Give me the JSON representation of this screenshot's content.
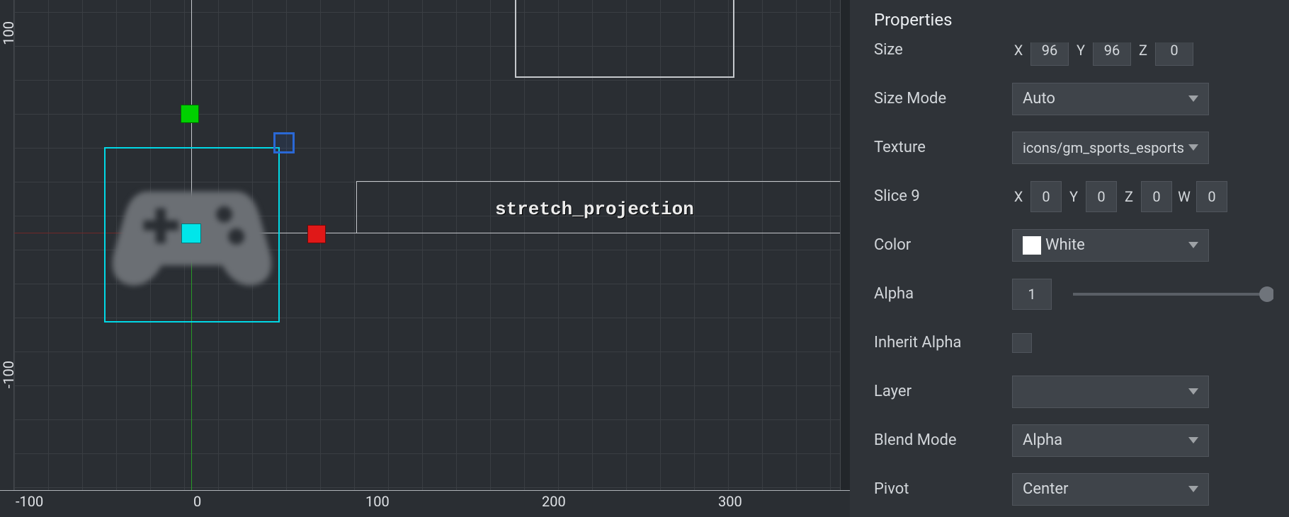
{
  "viewport": {
    "node_label": "stretch_projection",
    "ruler_x": [
      "-100",
      "0",
      "100",
      "200",
      "300"
    ],
    "ruler_y_top": "100",
    "ruler_y_bottom": "-100"
  },
  "properties": {
    "title": "Properties",
    "size": {
      "label": "Size",
      "xl": "X",
      "xv": "96",
      "yl": "Y",
      "yv": "96",
      "zl": "Z",
      "zv": "0"
    },
    "size_mode": {
      "label": "Size Mode",
      "value": "Auto"
    },
    "texture": {
      "label": "Texture",
      "value": "icons/gm_sports_esports"
    },
    "slice9": {
      "label": "Slice 9",
      "xl": "X",
      "xv": "0",
      "yl": "Y",
      "yv": "0",
      "zl": "Z",
      "zv": "0",
      "wl": "W",
      "wv": "0"
    },
    "color": {
      "label": "Color",
      "value": "White"
    },
    "alpha": {
      "label": "Alpha",
      "value": "1"
    },
    "inherit_alpha": {
      "label": "Inherit Alpha"
    },
    "layer": {
      "label": "Layer",
      "value": ""
    },
    "blend_mode": {
      "label": "Blend Mode",
      "value": "Alpha"
    },
    "pivot": {
      "label": "Pivot",
      "value": "Center"
    }
  }
}
